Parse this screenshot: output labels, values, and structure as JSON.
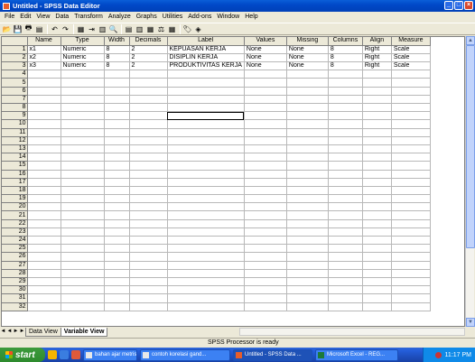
{
  "window": {
    "title": "Untitled - SPSS Data Editor",
    "controls": [
      "_",
      "□",
      "×"
    ]
  },
  "menu": [
    "File",
    "Edit",
    "View",
    "Data",
    "Transform",
    "Analyze",
    "Graphs",
    "Utilities",
    "Add-ons",
    "Window",
    "Help"
  ],
  "toolbar_icons": [
    "open-icon",
    "save-icon",
    "print-icon",
    "dialog-recall-icon",
    "undo-icon",
    "redo-icon",
    "goto-chart-icon",
    "goto-case-icon",
    "variables-icon",
    "find-icon",
    "insert-case-icon",
    "insert-variable-icon",
    "split-file-icon",
    "weight-cases-icon",
    "select-cases-icon",
    "value-labels-icon",
    "use-sets-icon"
  ],
  "columns": [
    "Name",
    "Type",
    "Width",
    "Decimals",
    "Label",
    "Values",
    "Missing",
    "Columns",
    "Align",
    "Measure"
  ],
  "rows": [
    {
      "num": "1",
      "cells": [
        "x1",
        "Numeric",
        "8",
        "2",
        "KEPUASAN KERJA",
        "None",
        "None",
        "8",
        "Right",
        "Scale"
      ]
    },
    {
      "num": "2",
      "cells": [
        "x2",
        "Numeric",
        "8",
        "2",
        "DISIPLIN KERJA",
        "None",
        "None",
        "8",
        "Right",
        "Scale"
      ]
    },
    {
      "num": "3",
      "cells": [
        "x3",
        "Numeric",
        "8",
        "2",
        "PRODUKTIVITAS KERJA",
        "None",
        "None",
        "8",
        "Right",
        "Scale"
      ]
    }
  ],
  "empty_row_numbers": [
    "4",
    "5",
    "6",
    "7",
    "8",
    "9",
    "10",
    "11",
    "12",
    "13",
    "14",
    "15",
    "16",
    "17",
    "18",
    "19",
    "20",
    "21",
    "22",
    "23",
    "24",
    "25",
    "26",
    "27",
    "28",
    "29",
    "30",
    "31",
    "32"
  ],
  "tabs": [
    "Data View",
    "Variable View"
  ],
  "active_tab": "Variable View",
  "status": "SPSS Processor  is ready",
  "taskbar": {
    "start": "start",
    "tasks": [
      "bahan ajar metris",
      "contoh korelasi gand...",
      "Untitled - SPSS Data ...",
      "Microsoft Excel - REG..."
    ],
    "active_task": "Untitled - SPSS Data ...",
    "clock": "11:17 PM"
  }
}
